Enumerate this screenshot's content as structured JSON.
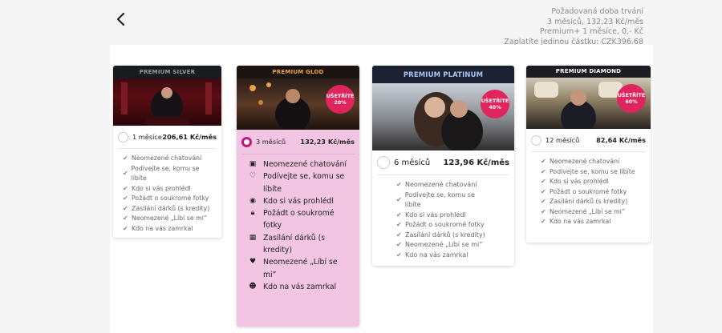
{
  "summary": {
    "line1": "Požadovaná doba trvání",
    "line2": "3 měsíců, 132,23 Kč/měs",
    "line3": "Premium+ 1 měsíce, 0,- Kč",
    "line4": "Zaplatíte jedinou částku: CZK396.68"
  },
  "colors": {
    "accent": "#e0245e",
    "selected_bg": "#f2c5e3",
    "radio_selected": "#c0157a"
  },
  "cards": [
    {
      "title": "PREMIUM SILVER",
      "period": "1 měsíce",
      "price": "206,61 Kč/měs",
      "features": [
        "Neomezené chatování",
        "Podívejte se, komu se líbíte",
        "Kdo si vás prohlédl",
        "Požádt o soukromé fotky",
        "Zasílání dárků (s kredity)",
        "Neomezené „Líbí se mi”",
        "Kdo na vás zamrkal"
      ]
    },
    {
      "title": "PREMIUM GLOD",
      "badge": "UŠETŘÍTE 20%",
      "period": "3 měsíců",
      "price": "132,23 Kč/měs",
      "selected": true,
      "features": [
        "Neomezené chatování",
        "Podívejte se, komu se líbíte",
        "Kdo si vás prohlédl",
        "Požádt o soukromé fotky",
        "Zasílání dárků (s kredity)",
        "Neomezené „Líbí se mi”",
        "Kdo na vás zamrkal"
      ],
      "feature_icons": [
        "chat-icon",
        "heart-outline-icon",
        "eye-icon",
        "lock-icon",
        "gift-icon",
        "heart-icon",
        "wink-icon"
      ]
    },
    {
      "title": "PREMIUM PLATINUM",
      "badge": "UŠETŘÍTE 40%",
      "period": "6 měsíců",
      "price": "123,96 Kč/měs",
      "features": [
        "Neomezené chatování",
        "Podívejte se, komu se líbíte",
        "Kdo si vás prohlédl",
        "Požádt o soukromé fotky",
        "Zasílání dárků (s kredity)",
        "Neomezené „Líbí se mi”",
        "Kdo na vás zamrkal"
      ]
    },
    {
      "title": "PREMIUM DIAMOND",
      "badge": "UŠETŘÍTE 60%",
      "period": "12 měsíců",
      "price": "82,64 Kč/měs",
      "features": [
        "Neomezené chatování",
        "Podívejte se, komu se líbíte",
        "Kdo si vás prohlédl",
        "Požádt o soukromé fotky",
        "Zasílání dárků (s kredity)",
        "Neomezené „Líbí se mi”",
        "Kdo na vás zamrkal"
      ]
    }
  ]
}
